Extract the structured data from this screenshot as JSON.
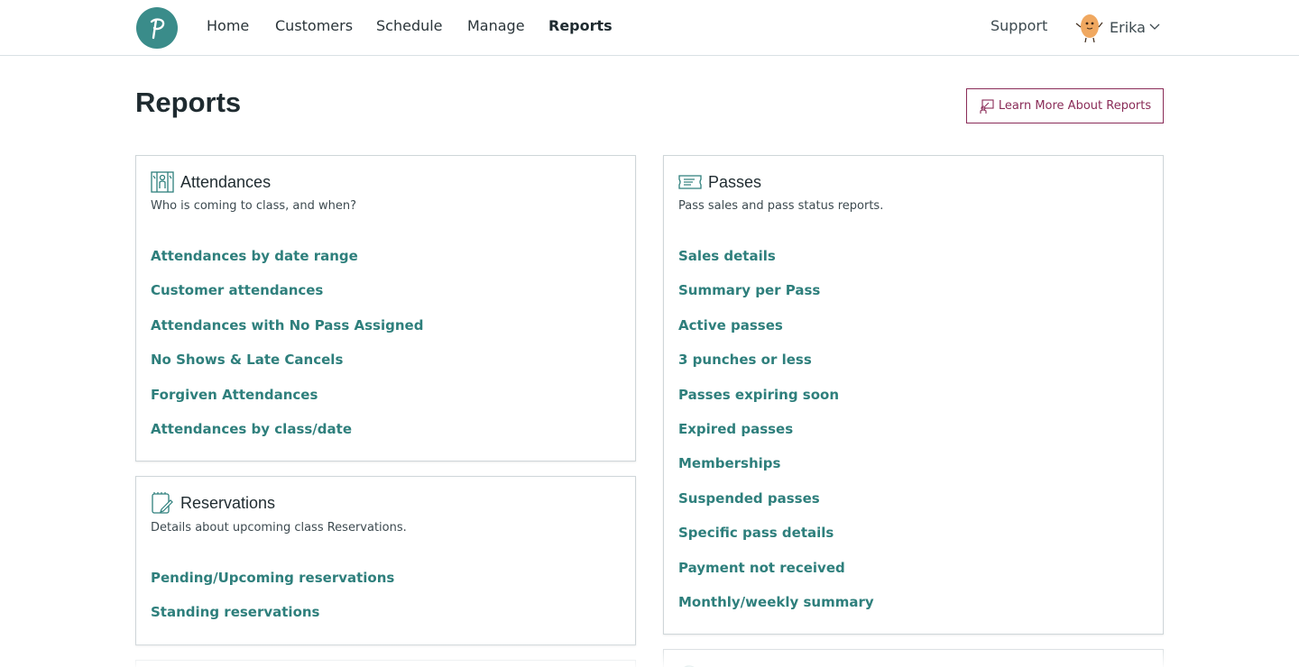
{
  "nav": {
    "items": [
      {
        "label": "Home",
        "active": false
      },
      {
        "label": "Customers",
        "active": false
      },
      {
        "label": "Schedule",
        "active": false
      },
      {
        "label": "Manage",
        "active": false
      },
      {
        "label": "Reports",
        "active": true
      }
    ],
    "support": "Support",
    "user": "Erika",
    "logo_icon": "p-logo-icon",
    "accent_color": "#3a8c8a"
  },
  "header": {
    "title": "Reports",
    "learn_more": "Learn More About Reports",
    "learn_more_color": "#8a2c58"
  },
  "cards": {
    "attendances": {
      "title": "Attendances",
      "description": "Who is coming to class, and when?",
      "icon": "attendances-icon",
      "links": [
        "Attendances by date range",
        "Customer attendances",
        "Attendances with No Pass Assigned",
        "No Shows & Late Cancels",
        "Forgiven Attendances",
        "Attendances by class/date"
      ]
    },
    "reservations": {
      "title": "Reservations",
      "description": "Details about upcoming class Reservations.",
      "icon": "notepad-icon",
      "links": [
        "Pending/Upcoming reservations",
        "Standing reservations"
      ]
    },
    "passes": {
      "title": "Passes",
      "description": "Pass sales and pass status reports.",
      "icon": "ticket-icon",
      "links": [
        "Sales details",
        "Summary per Pass",
        "Active passes",
        "3 punches or less",
        "Passes expiring soon",
        "Expired passes",
        "Memberships",
        "Suspended passes",
        "Specific pass details",
        "Payment not received",
        "Monthly/weekly summary"
      ]
    }
  },
  "link_color": "#2e7f7c"
}
